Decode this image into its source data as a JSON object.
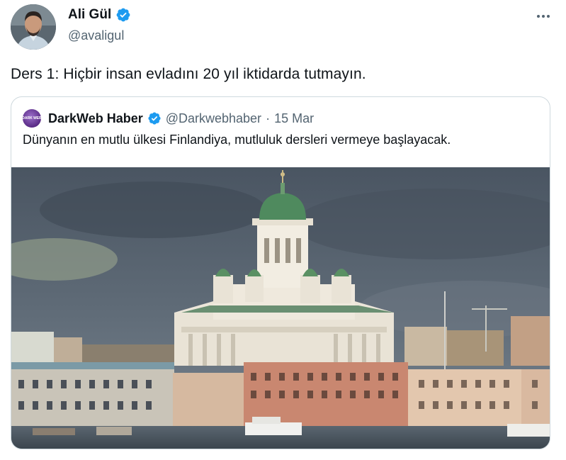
{
  "tweet": {
    "author_name": "Ali Gül",
    "author_handle": "@avaligul",
    "text": "Ders 1: Hiçbir insan evladını 20 yıl iktidarda tutmayın."
  },
  "quoted": {
    "author_name": "DarkWeb Haber",
    "author_handle": "@Darkwebhaber",
    "separator": "·",
    "date": "15 Mar",
    "text": "Dünyanın en mutlu ülkesi Finlandiya, mutluluk dersleri vermeye başlayacak.",
    "avatar_text": "DARK WEB"
  },
  "icons": {
    "verified": "verified-badge-icon",
    "more": "more-options-icon"
  },
  "colors": {
    "verified_blue": "#1d9bf0",
    "secondary_text": "#536471",
    "border": "#cfd9de"
  }
}
